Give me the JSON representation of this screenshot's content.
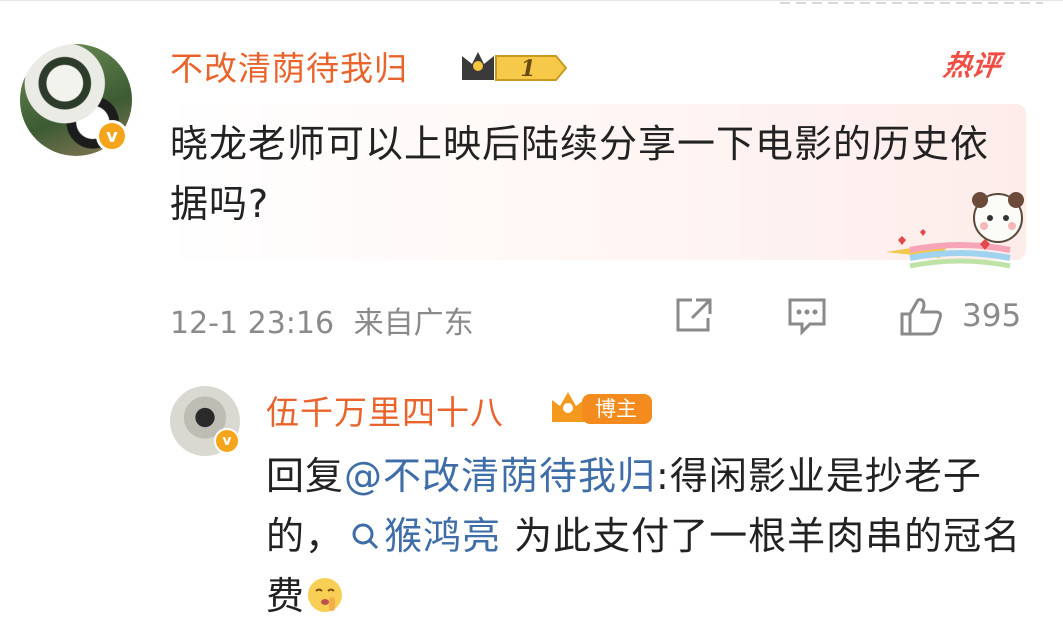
{
  "comment": {
    "username": "不改清荫待我归",
    "fan_level": "1",
    "hot_label": "热评",
    "text": "晓龙老师可以上映后陆续分享一下电影的历史依据吗?",
    "timestamp": "12-1 23:16",
    "location": "来自广东",
    "like_count": "395",
    "verified_mark": "v"
  },
  "reply": {
    "username": "伍千万里四十八",
    "role_badge": "博主",
    "reply_prefix": "回复",
    "mention": "@不改清荫待我归",
    "text_part1": ":得闲影业是抄老子的，",
    "search_link": "猴鸿亮",
    "text_part2": " 为此支付了一根羊肉串的冠名费",
    "verified_mark": "v"
  },
  "colors": {
    "username": "#e9642c",
    "link": "#3e6da8",
    "meta": "#8a8a8a",
    "hot": "#f04e44"
  },
  "icons": [
    "share-icon",
    "comment-icon",
    "like-icon",
    "search-icon",
    "shush-emoji",
    "crown-icon"
  ]
}
